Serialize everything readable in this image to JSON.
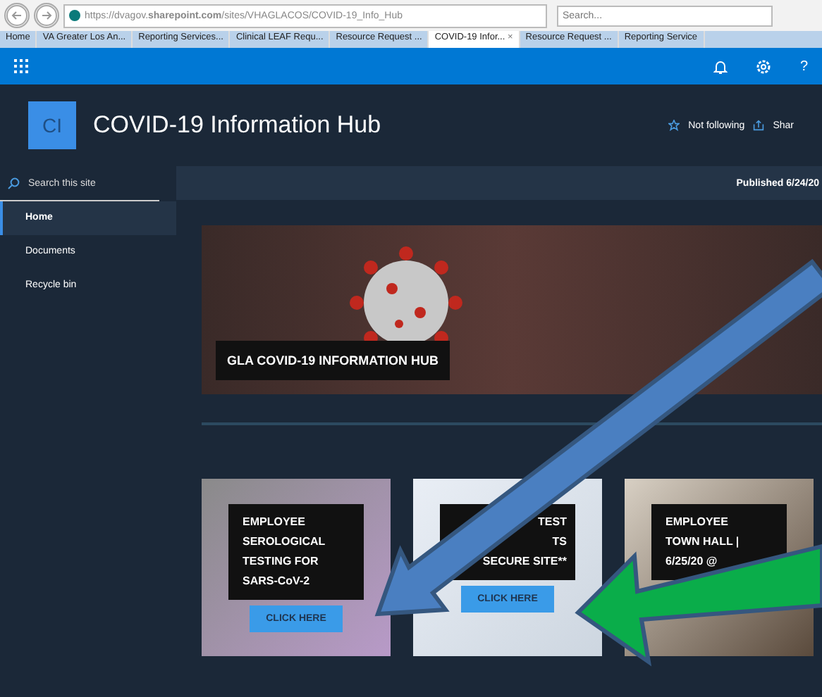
{
  "browser": {
    "url": "https://dvagov.**sharepoint.com**/sites/VHAGLACOS/COVID-19_Info_Hub",
    "search": {
      "placeholder": "Search..."
    },
    "tabs": [
      {
        "label": "Home",
        "selected": false
      },
      {
        "label": "VA Greater Los An...",
        "selected": false
      },
      {
        "label": "Reporting Services...",
        "selected": false
      },
      {
        "label": "Clinical LEAF Requ...",
        "selected": false
      },
      {
        "label": "Resource Request ...",
        "selected": false
      },
      {
        "label": "COVID-19 Infor...",
        "selected": true,
        "close": "×"
      },
      {
        "label": "Resource Request ...",
        "selected": false
      },
      {
        "label": "Reporting Service",
        "selected": false
      }
    ]
  },
  "suite_bar": {
    "help": "?"
  },
  "site": {
    "logo": "CI",
    "title": "COVID-19 Information Hub",
    "follow": "Not following",
    "share": "Shar"
  },
  "sidebar": {
    "search": {
      "placeholder": "Search this site"
    },
    "items": [
      {
        "label": "Home",
        "selected": true
      },
      {
        "label": "Documents",
        "selected": false
      },
      {
        "label": "Recycle bin",
        "selected": false
      }
    ]
  },
  "page": {
    "published": "Published 6/24/20",
    "hero_caption": "GLA COVID-19 INFORMATION HUB",
    "cards": [
      {
        "lines": [
          "EMPLOYEE",
          "SEROLOGICAL",
          "TESTING FOR",
          "SARS-CoV-2"
        ],
        "button": "CLICK HERE"
      },
      {
        "lines": [
          "TEST",
          "TS",
          "SECURE SITE**"
        ],
        "button": "CLICK HERE"
      },
      {
        "lines": [
          "EMPLOYEE",
          "TOWN HALL |",
          "6/25/20 @"
        ]
      }
    ]
  }
}
